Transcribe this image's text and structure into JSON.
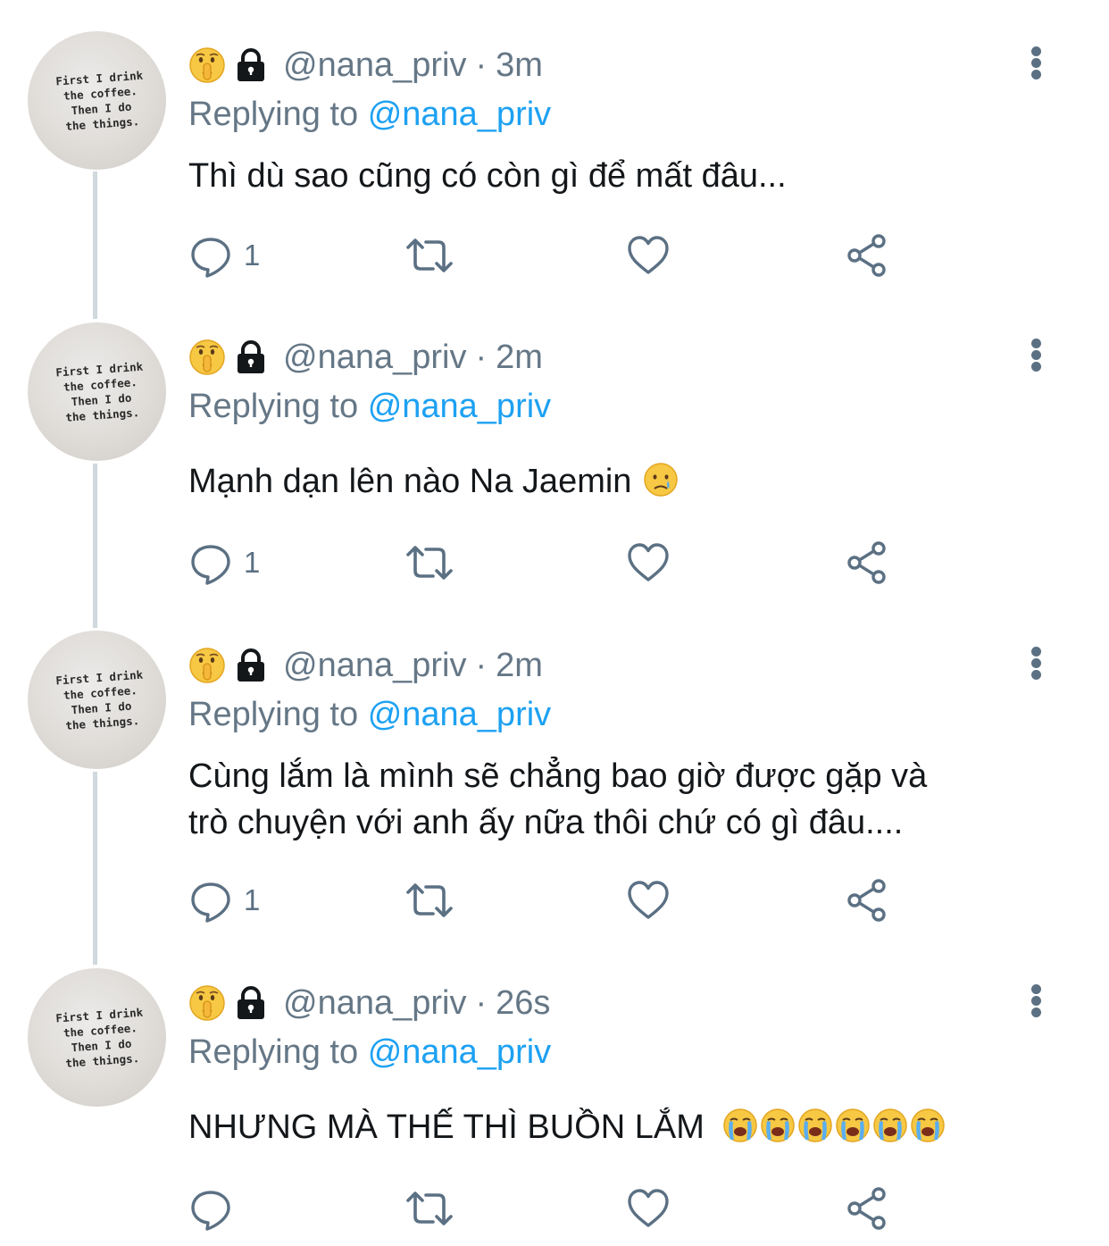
{
  "avatar_text": "First I drink\nthe coffee.\nThen I do\nthe things.",
  "replying_prefix": "Replying to",
  "tweets": [
    {
      "handle": "@nana_priv",
      "time": "3m",
      "replying_to": "@nana_priv",
      "text_lines": [
        "Thì dù sao cũng có còn gì để mất đâu..."
      ],
      "emojis": [],
      "reply_count": "1"
    },
    {
      "handle": "@nana_priv",
      "time": "2m",
      "replying_to": "@nana_priv",
      "text_lines": [
        "Mạnh dạn lên nào Na Jaemin"
      ],
      "emojis": [
        "crying-face"
      ],
      "reply_count": "1"
    },
    {
      "handle": "@nana_priv",
      "time": "2m",
      "replying_to": "@nana_priv",
      "text_lines": [
        "Cùng lắm là mình sẽ chẳng bao giờ được gặp và",
        "trò chuyện với anh ấy nữa thôi chứ có gì đâu...."
      ],
      "emojis": [],
      "reply_count": "1"
    },
    {
      "handle": "@nana_priv",
      "time": "26s",
      "replying_to": "@nana_priv",
      "text_lines": [
        "NHƯNG MÀ THẾ THÌ BUỒN LẮM"
      ],
      "emojis": [
        "loudly-crying-face",
        "loudly-crying-face",
        "loudly-crying-face",
        "loudly-crying-face",
        "loudly-crying-face",
        "loudly-crying-face"
      ],
      "reply_count": ""
    }
  ],
  "colors": {
    "secondary_text": "#657786",
    "link": "#1da1f2",
    "thread_line": "#cfd9de",
    "icon": "#5b7083"
  },
  "icons": {
    "header": [
      "shushing-face-icon",
      "lock-icon"
    ],
    "actions": [
      "reply-icon",
      "retweet-icon",
      "like-icon",
      "share-icon"
    ],
    "menu": "more-options-icon"
  }
}
